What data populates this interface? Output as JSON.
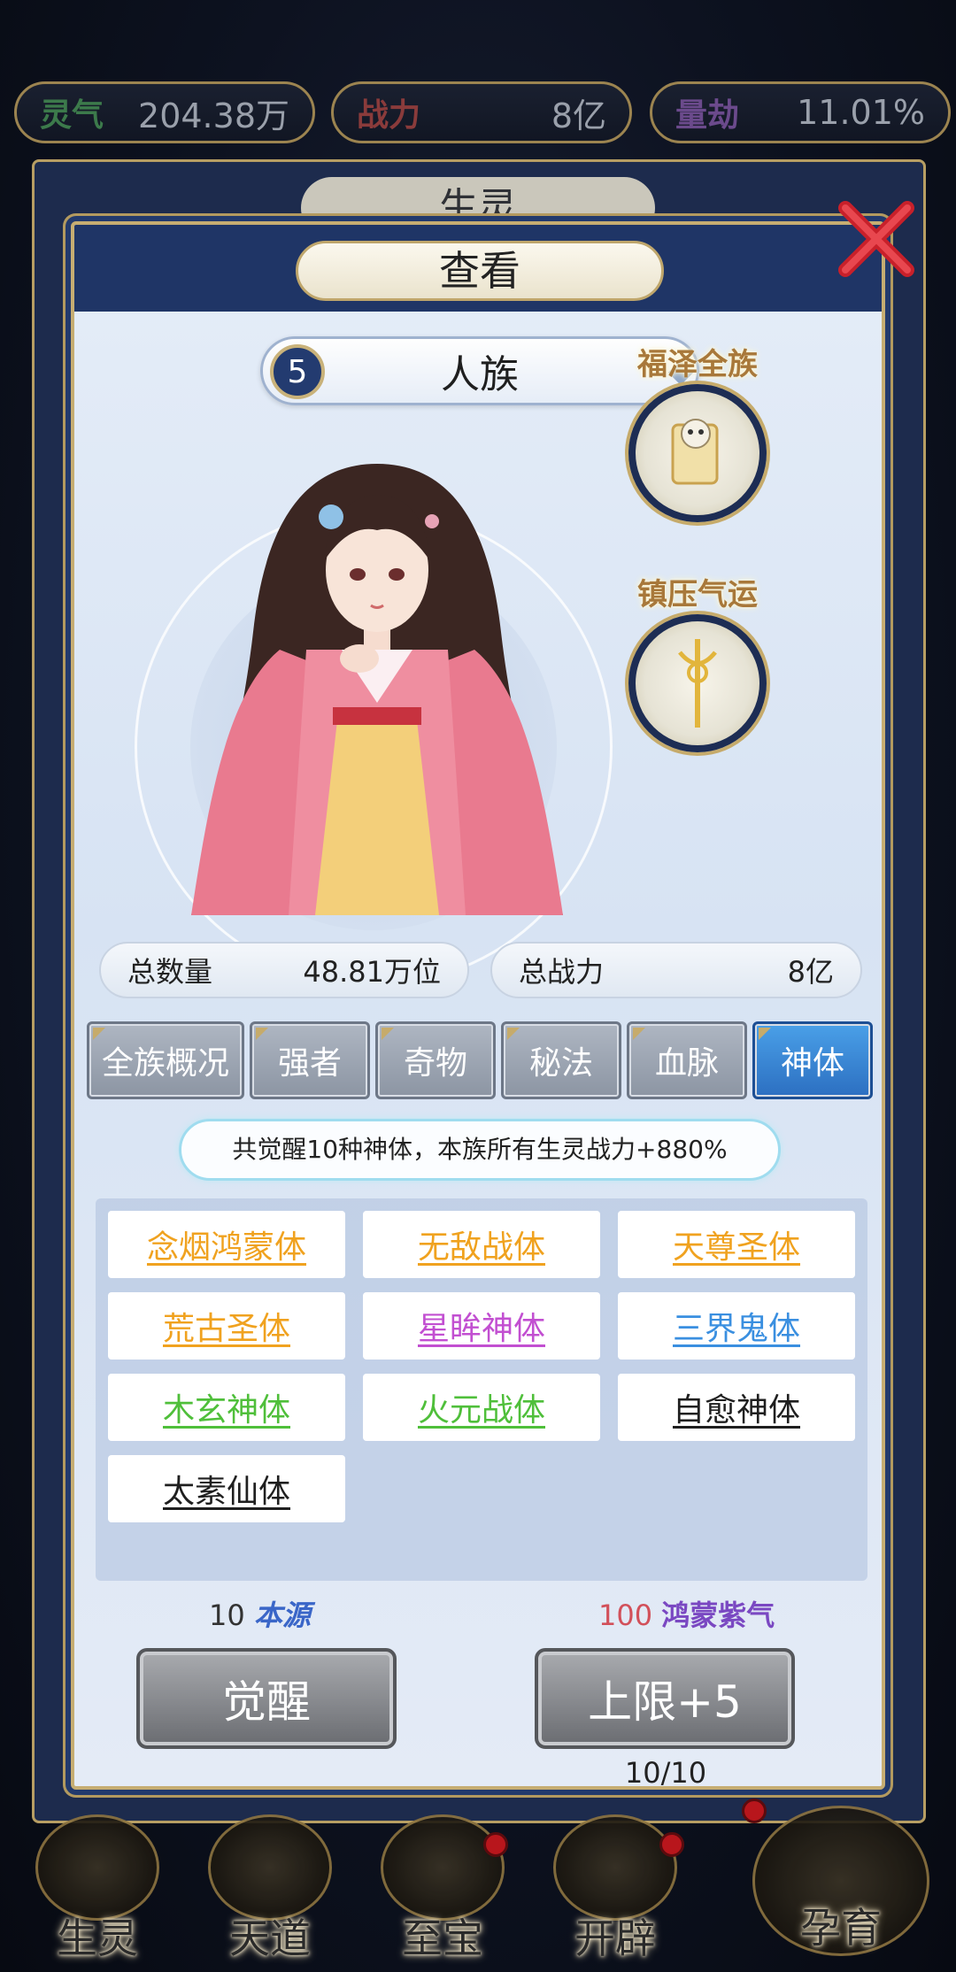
{
  "resources": [
    {
      "label": "灵气",
      "value": "204.38万"
    },
    {
      "label": "战力",
      "value": "8亿"
    },
    {
      "label": "量劫",
      "value": "11.01%"
    }
  ],
  "background_panel": {
    "title": "生灵"
  },
  "dialog": {
    "title": "查看",
    "race": {
      "level": "5",
      "name": "人族"
    },
    "skills": [
      {
        "label": "福泽全族",
        "icon": "golden-skull-scroll-icon"
      },
      {
        "label": "镇压气运",
        "icon": "golden-trident-icon"
      }
    ],
    "stats": [
      {
        "label": "总数量",
        "value": "48.81万位"
      },
      {
        "label": "总战力",
        "value": "8亿"
      }
    ],
    "tabs": [
      "全族概况",
      "强者",
      "奇物",
      "秘法",
      "血脉",
      "神体"
    ],
    "active_tab": "神体",
    "summary": "共觉醒10种神体，本族所有生灵战力+880%",
    "physiques": [
      {
        "name": "念烟鸿蒙体",
        "color": "#f0a21f"
      },
      {
        "name": "无敌战体",
        "color": "#f0a21f"
      },
      {
        "name": "天尊圣体",
        "color": "#f0a21f"
      },
      {
        "name": "荒古圣体",
        "color": "#f0a21f"
      },
      {
        "name": "星眸神体",
        "color": "#c24fd1"
      },
      {
        "name": "三界鬼体",
        "color": "#3a8fe0"
      },
      {
        "name": "木玄神体",
        "color": "#4fbf3a"
      },
      {
        "name": "火元战体",
        "color": "#4fbf3a"
      },
      {
        "name": "自愈神体",
        "color": "#1f1f1f"
      },
      {
        "name": "太素仙体",
        "color": "#1f1f1f"
      }
    ],
    "costs": [
      {
        "amount": "10",
        "item": "本源"
      },
      {
        "amount": "100",
        "item": "鸿蒙紫气"
      }
    ],
    "buttons": {
      "awaken": "觉醒",
      "limit": "上限+5"
    },
    "limit_counter": "10/10"
  },
  "nav": [
    "生灵",
    "天道",
    "至宝",
    "开辟",
    "孕育"
  ]
}
